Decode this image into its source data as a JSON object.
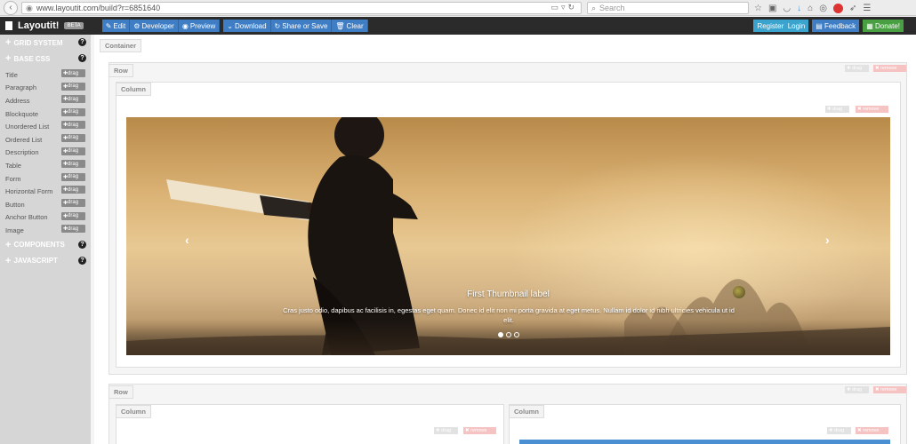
{
  "browser": {
    "url": "www.layoutit.com/build?r=6851640",
    "search_placeholder": "Search"
  },
  "app": {
    "brand": "Layoutit!",
    "badge": "BETA",
    "toolbar": {
      "edit": "Edit",
      "developer": "Developer",
      "preview": "Preview",
      "download": "Download",
      "share": "Share or Save",
      "clear": "Clear"
    },
    "right": {
      "register": "Register",
      "login": "Login",
      "feedback": "Feedback",
      "donate": "Donate!"
    }
  },
  "sidebar": {
    "sections": {
      "grid": "Grid system",
      "base": "Base CSS",
      "components": "Components",
      "javascript": "Javascript"
    },
    "drag_label": "drag",
    "items": [
      "Title",
      "Paragraph",
      "Address",
      "Blockquote",
      "Unordered List",
      "Ordered List",
      "Description",
      "Table",
      "Form",
      "Horizontal Form",
      "Button",
      "Anchor Button",
      "Image"
    ]
  },
  "canvas": {
    "container_label": "Container",
    "row_label": "Row",
    "column_label": "Column",
    "drag_label": "drag",
    "remove_label": "remove",
    "carousel": {
      "title": "First Thumbnail label",
      "text": "Cras justo odio, dapibus ac facilisis in, egestas eget quam. Donec id elit non mi porta gravida at eget metus. Nullam id dolor id nibh ultricies vehicula ut id elit.",
      "slides": 3,
      "active": 1
    }
  }
}
